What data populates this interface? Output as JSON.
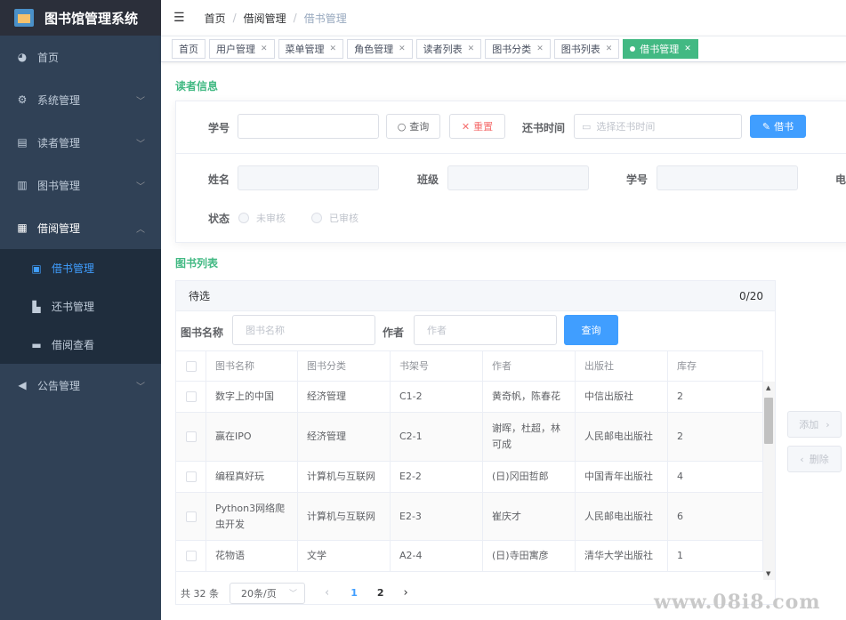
{
  "app": {
    "title": "图书馆管理系统"
  },
  "sidebar": {
    "items": [
      {
        "label": "首页",
        "icon": "dashboard-icon"
      },
      {
        "label": "系统管理",
        "icon": "gear-icon"
      },
      {
        "label": "读者管理",
        "icon": "id-card-icon"
      },
      {
        "label": "图书管理",
        "icon": "books-icon"
      },
      {
        "label": "借阅管理",
        "icon": "document-icon"
      },
      {
        "label": "公告管理",
        "icon": "megaphone-icon"
      }
    ],
    "submenu": [
      {
        "label": "借书管理",
        "icon": "book-icon"
      },
      {
        "label": "还书管理",
        "icon": "return-icon"
      },
      {
        "label": "借阅查看",
        "icon": "briefcase-icon"
      }
    ]
  },
  "breadcrumb": [
    "首页",
    "借阅管理",
    "借书管理"
  ],
  "tags": [
    "首页",
    "用户管理",
    "菜单管理",
    "角色管理",
    "读者列表",
    "图书分类",
    "图书列表",
    "借书管理"
  ],
  "reader": {
    "section_title": "读者信息",
    "student_id_label": "学号",
    "query_label": "查询",
    "reset_label": "重置",
    "return_time_label": "还书时间",
    "return_time_placeholder": "选择还书时间",
    "borrow_label": "借书",
    "name_label": "姓名",
    "class_label": "班级",
    "student_id_label2": "学号",
    "phone_label_partial": "电",
    "status_label": "状态",
    "status_options": [
      "未审核",
      "已审核"
    ]
  },
  "books": {
    "section_title": "图书列表",
    "panel_title": "待选",
    "panel_count": "0/20",
    "name_label": "图书名称",
    "name_placeholder": "图书名称",
    "author_label": "作者",
    "author_placeholder": "作者",
    "query_label": "查询",
    "columns": [
      "图书名称",
      "图书分类",
      "书架号",
      "作者",
      "出版社",
      "库存"
    ],
    "rows": [
      [
        "数字上的中国",
        "经济管理",
        "C1-2",
        "黄奇帆，陈春花",
        "中信出版社",
        "2"
      ],
      [
        "赢在IPO",
        "经济管理",
        "C2-1",
        "谢晖，杜超，林可成",
        "人民邮电出版社",
        "2"
      ],
      [
        "编程真好玩",
        "计算机与互联网",
        "E2-2",
        "(日)冈田哲郎",
        "中国青年出版社",
        "4"
      ],
      [
        "Python3网络爬虫开发",
        "计算机与互联网",
        "E2-3",
        "崔庆才",
        "人民邮电出版社",
        "6"
      ],
      [
        "花物语",
        "文学",
        "A2-4",
        "(日)寺田寓彦",
        "清华大学出版社",
        "1"
      ]
    ],
    "total": "共 32 条",
    "page_size": "20条/页",
    "pages": [
      "1",
      "2"
    ]
  },
  "transfer": {
    "add_label": "添加",
    "remove_label": "删除"
  },
  "watermark": "www.08i8.com"
}
